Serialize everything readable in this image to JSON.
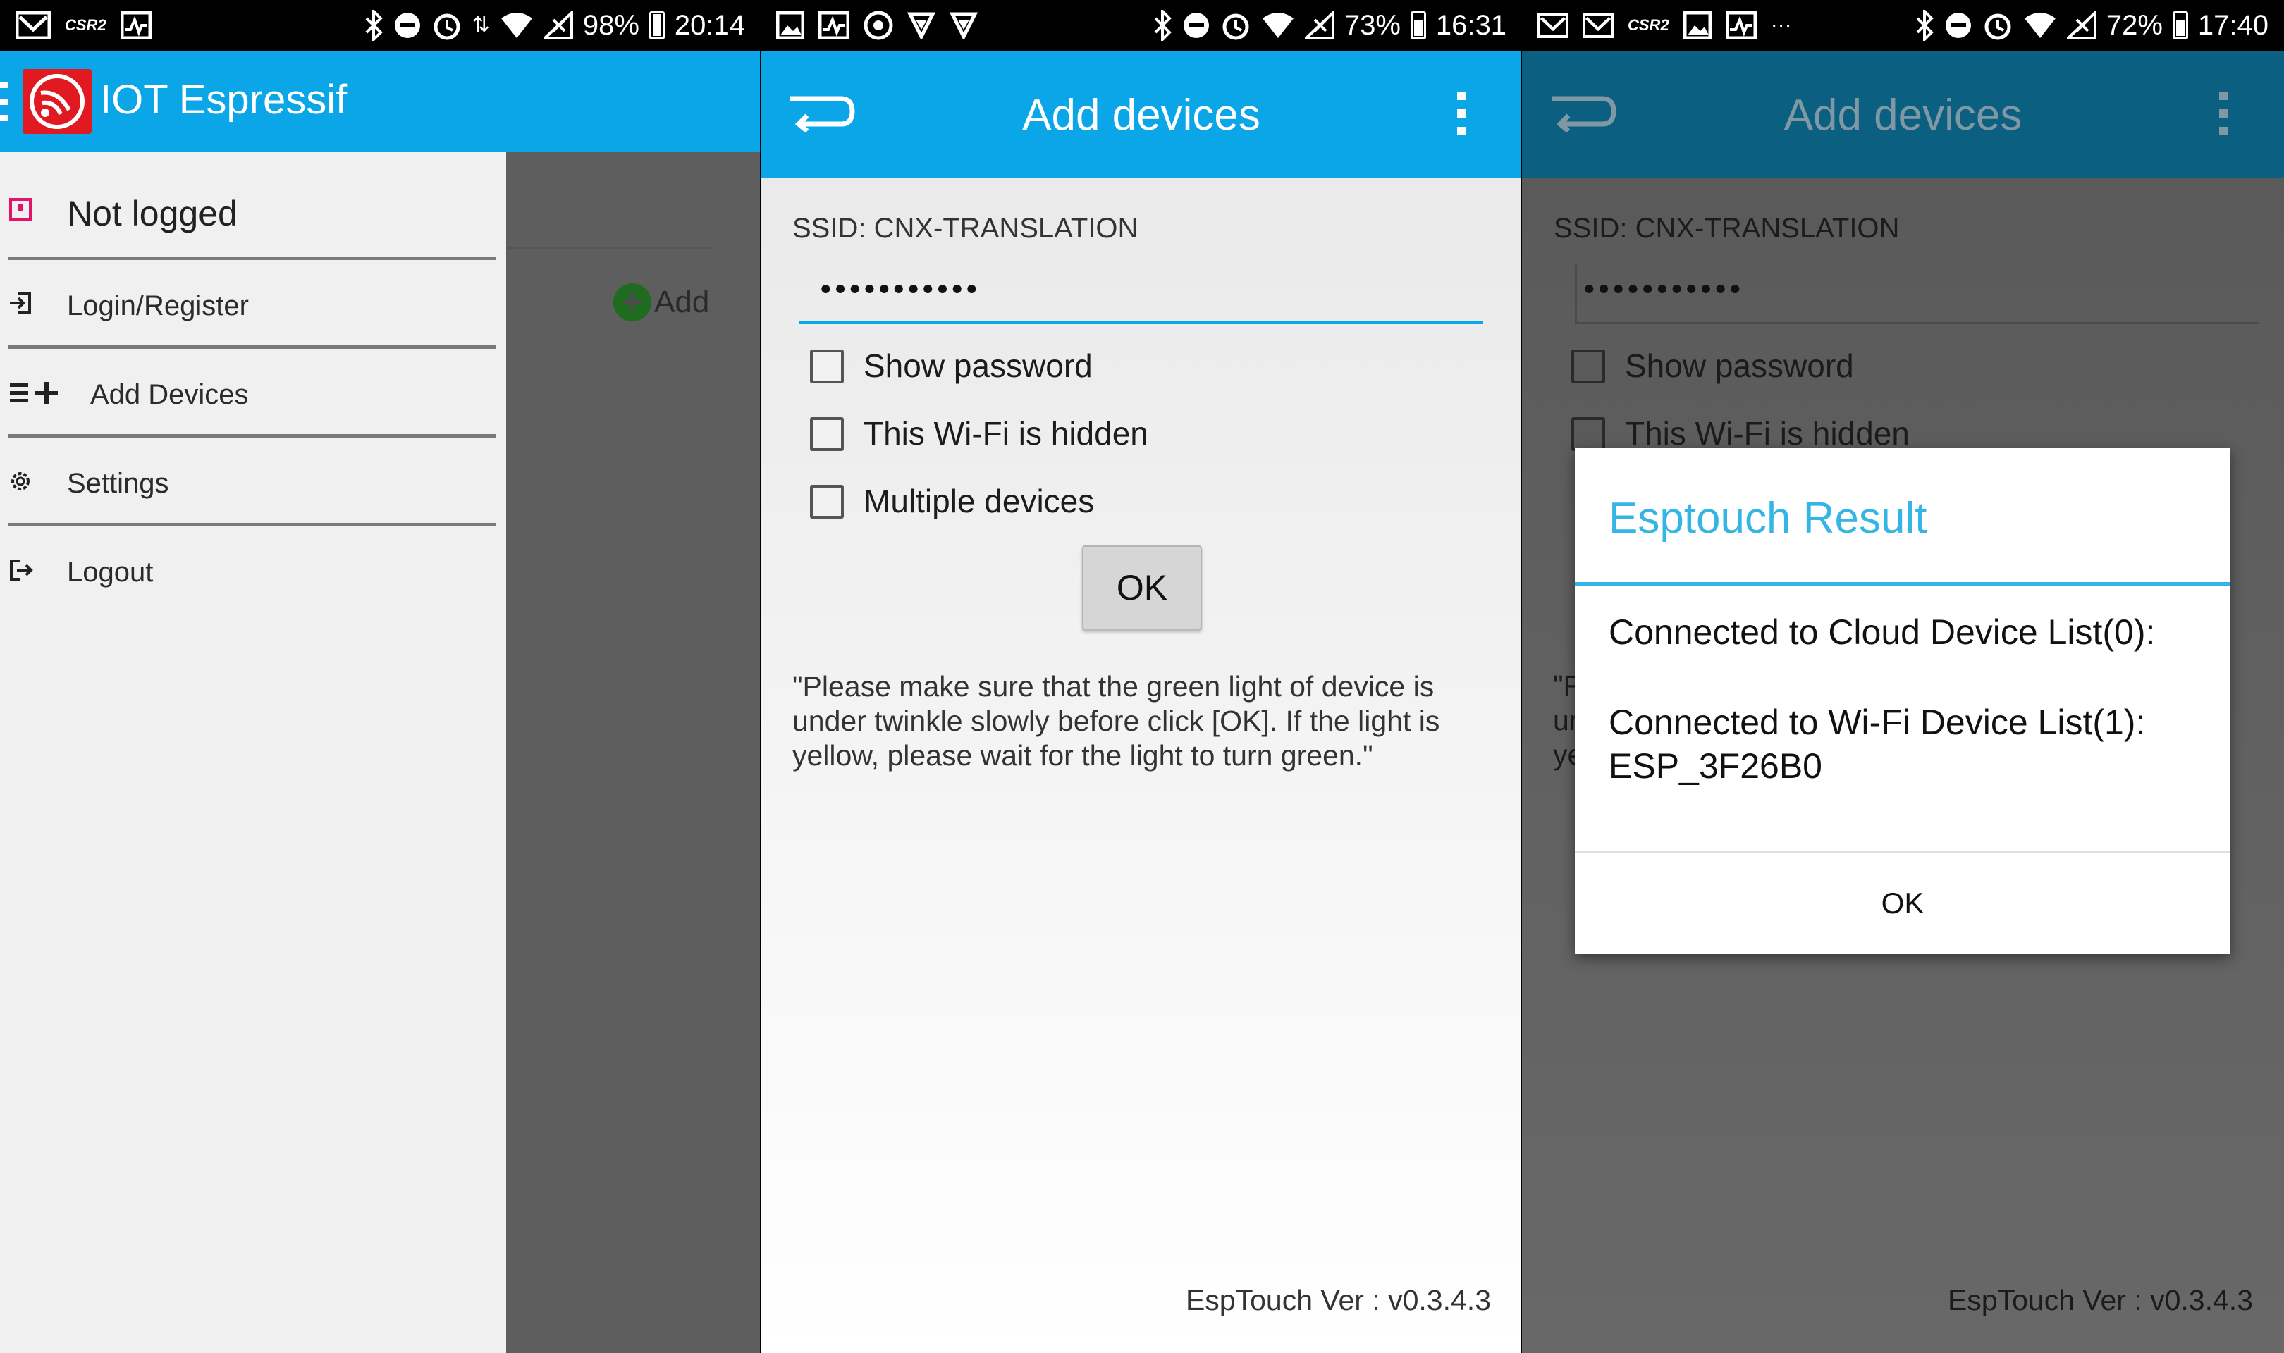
{
  "screen1": {
    "status": {
      "battery": "98%",
      "time": "20:14"
    },
    "app_title": "IOT Espressif",
    "background_add_label": "Add",
    "drawer": {
      "header": "Not logged",
      "items": [
        {
          "label": "Login/Register",
          "icon": "login-icon"
        },
        {
          "label": "Add Devices",
          "icon": "add-devices-icon"
        },
        {
          "label": "Settings",
          "icon": "gear-icon"
        },
        {
          "label": "Logout",
          "icon": "logout-icon"
        }
      ]
    }
  },
  "screen2": {
    "status": {
      "battery": "73%",
      "time": "16:31"
    },
    "title": "Add devices",
    "ssid_label": "SSID: CNX-TRANSLATION",
    "password_value": "•••••••••••",
    "checkboxes": [
      {
        "label": "Show password",
        "checked": false
      },
      {
        "label": "This Wi-Fi is hidden",
        "checked": false
      },
      {
        "label": "Multiple devices",
        "checked": false
      }
    ],
    "ok_label": "OK",
    "note": "\"Please make sure that the green light of device is under twinkle slowly before click [OK]. If the light is yellow, please wait for the light to turn green.\"",
    "version": "EspTouch Ver : v0.3.4.3"
  },
  "screen3": {
    "status": {
      "battery": "72%",
      "time": "17:40"
    },
    "title": "Add devices",
    "ssid_label": "SSID: CNX-TRANSLATION",
    "password_value": "•••••••••••",
    "checkboxes": [
      {
        "label": "Show password"
      },
      {
        "label": "This Wi-Fi is hidden"
      }
    ],
    "partial_note": [
      "\"F",
      "ur",
      "ye"
    ],
    "version": "EspTouch Ver : v0.3.4.3",
    "dialog": {
      "title": "Esptouch Result",
      "line1": "Connected to Cloud Device List(0):",
      "line2": "Connected to Wi-Fi Device List(1):",
      "line3": "ESP_3F26B0",
      "ok_label": "OK"
    }
  },
  "colors": {
    "accent": "#0aa6e8",
    "dialog_accent": "#33b5e5",
    "logo_red": "#e11a22"
  }
}
